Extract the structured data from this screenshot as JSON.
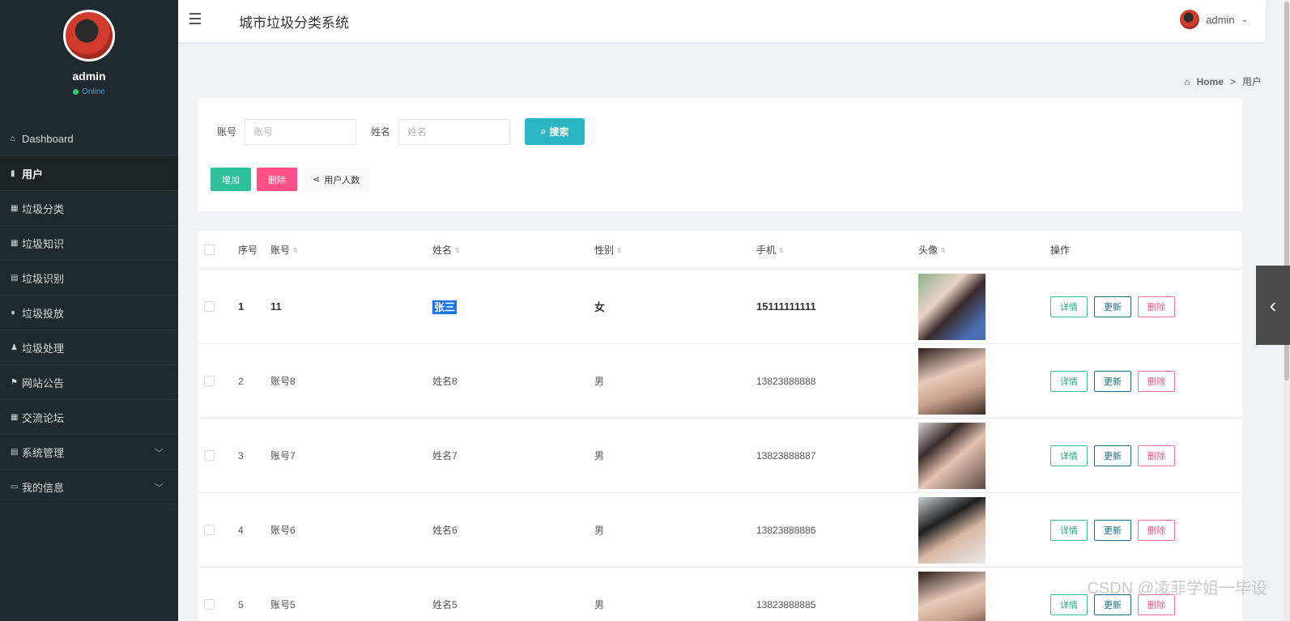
{
  "app": {
    "title": "城市垃圾分类系统",
    "username": "admin"
  },
  "sidebar": {
    "profile": {
      "name": "admin",
      "status": "Online"
    },
    "items": [
      {
        "label": "Dashboard",
        "icon": "home-icon"
      },
      {
        "label": "用户",
        "icon": "bar-chart-icon"
      },
      {
        "label": "垃圾分类",
        "icon": "grid-icon"
      },
      {
        "label": "垃圾知识",
        "icon": "grid-icon"
      },
      {
        "label": "垃圾识别",
        "icon": "clipboard-icon"
      },
      {
        "label": "垃圾投放",
        "icon": "bulb-icon"
      },
      {
        "label": "垃圾处理",
        "icon": "user-icon"
      },
      {
        "label": "网站公告",
        "icon": "flag-icon"
      },
      {
        "label": "交流论坛",
        "icon": "grid-icon"
      },
      {
        "label": "系统管理",
        "icon": "clipboard-icon"
      },
      {
        "label": "我的信息",
        "icon": "card-icon"
      }
    ]
  },
  "breadcrumb": {
    "home": "Home",
    "separator": ">",
    "current": "用户"
  },
  "search": {
    "account_label": "账号",
    "account_placeholder": "账号",
    "name_label": "姓名",
    "name_placeholder": "姓名",
    "search_button": "搜索"
  },
  "actions": {
    "add": "增加",
    "delete": "删除",
    "count": "用户人数"
  },
  "table": {
    "headers": {
      "index": "序号",
      "account": "账号",
      "name": "姓名",
      "gender": "性别",
      "phone": "手机",
      "avatar": "头像",
      "operations": "操作"
    },
    "op_labels": {
      "detail": "详情",
      "update": "更新",
      "delete": "删除"
    },
    "rows": [
      {
        "index": "1",
        "account": "11",
        "name": "张三",
        "gender": "女",
        "phone": "15111111111"
      },
      {
        "index": "2",
        "account": "账号8",
        "name": "姓名8",
        "gender": "男",
        "phone": "13823888888"
      },
      {
        "index": "3",
        "account": "账号7",
        "name": "姓名7",
        "gender": "男",
        "phone": "13823888887"
      },
      {
        "index": "4",
        "account": "账号6",
        "name": "姓名6",
        "gender": "男",
        "phone": "13823888886"
      },
      {
        "index": "5",
        "account": "账号5",
        "name": "姓名5",
        "gender": "男",
        "phone": "13823888885"
      }
    ]
  },
  "watermark": "CSDN @凌菲学姐一毕设",
  "colors": {
    "sidebar_bg": "#1f2a30",
    "search_btn": "#2ab6c5",
    "add_btn": "#2ec09a",
    "delete_btn": "#ff4f87"
  }
}
